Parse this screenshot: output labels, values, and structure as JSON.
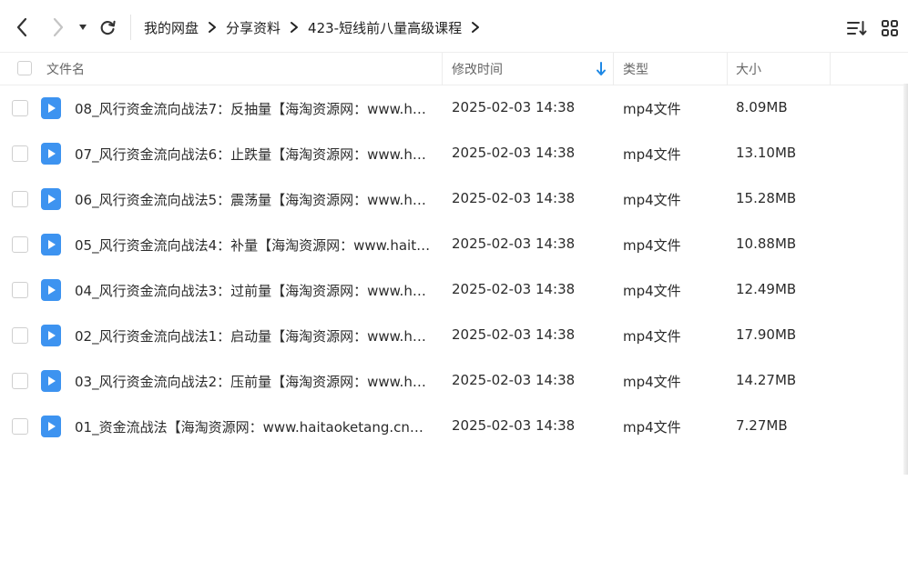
{
  "breadcrumb": [
    "我的网盘",
    "分享资料",
    "423-短线前八量高级课程"
  ],
  "icons": {
    "back": "chevron-left-icon",
    "forward": "chevron-right-icon",
    "history": "caret-down-icon",
    "refresh": "refresh-icon",
    "crumb_separator": "chevron-right-icon",
    "sort": "sort-list-icon",
    "grid": "grid-view-icon",
    "sort_direction": "arrow-down-icon",
    "file": "video-file-icon"
  },
  "columns": {
    "name": "文件名",
    "time": "修改时间",
    "type": "类型",
    "size": "大小"
  },
  "sorted_column": "修改时间",
  "files": [
    {
      "name": "08_风行资金流向战法7：反抽量【海淘资源网：www.ha...",
      "time": "2025-02-03 14:38",
      "type": "mp4文件",
      "size": "8.09MB"
    },
    {
      "name": "07_风行资金流向战法6：止跌量【海淘资源网：www.ha...",
      "time": "2025-02-03 14:38",
      "type": "mp4文件",
      "size": "13.10MB"
    },
    {
      "name": "06_风行资金流向战法5：震荡量【海淘资源网：www.ha...",
      "time": "2025-02-03 14:38",
      "type": "mp4文件",
      "size": "15.28MB"
    },
    {
      "name": "05_风行资金流向战法4：补量【海淘资源网：www.haita...",
      "time": "2025-02-03 14:38",
      "type": "mp4文件",
      "size": "10.88MB"
    },
    {
      "name": "04_风行资金流向战法3：过前量【海淘资源网：www.ha...",
      "time": "2025-02-03 14:38",
      "type": "mp4文件",
      "size": "12.49MB"
    },
    {
      "name": "02_风行资金流向战法1：启动量【海淘资源网：www.ha...",
      "time": "2025-02-03 14:38",
      "type": "mp4文件",
      "size": "17.90MB"
    },
    {
      "name": "03_风行资金流向战法2：压前量【海淘资源网：www.ha...",
      "time": "2025-02-03 14:38",
      "type": "mp4文件",
      "size": "14.27MB"
    },
    {
      "name": "01_资金流战法【海淘资源网：www.haitaoketang.cn】...",
      "time": "2025-02-03 14:38",
      "type": "mp4文件",
      "size": "7.27MB"
    }
  ],
  "colors": {
    "accent": "#1e88e5",
    "file_icon": "#3d93f0",
    "text": "#2b2b2b",
    "muted": "#666666"
  }
}
